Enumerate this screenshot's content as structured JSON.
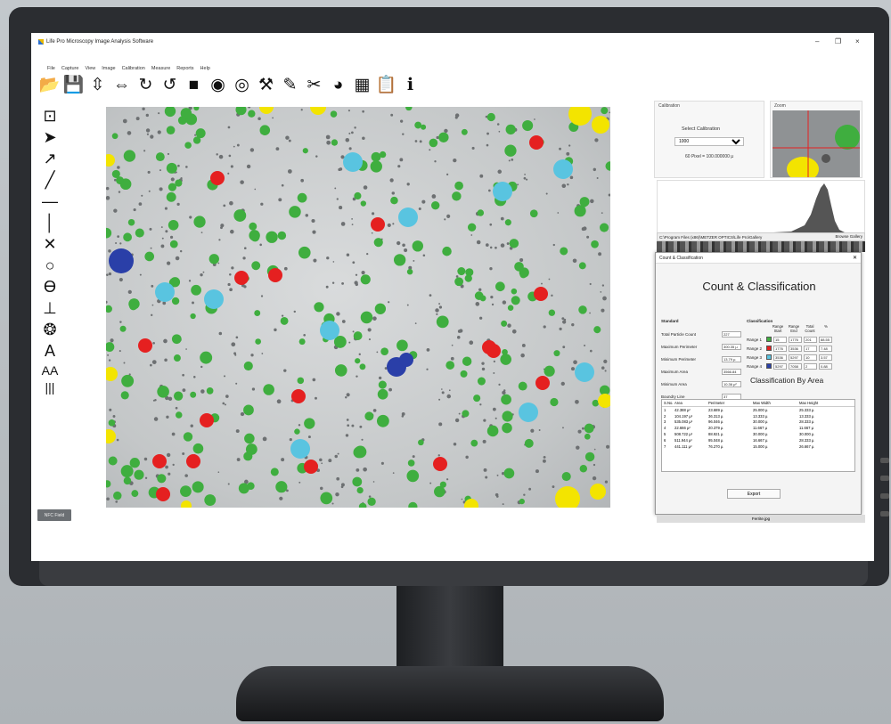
{
  "window": {
    "title": "Life Pro Microscopy Image Analysis Software",
    "controls": [
      "–",
      "❐",
      "×"
    ]
  },
  "menu": [
    "File",
    "Capture",
    "View",
    "Image",
    "Calibration",
    "Measure",
    "Reports",
    "Help"
  ],
  "toolbar": [
    {
      "name": "open-folder-icon",
      "glyph": "📂"
    },
    {
      "name": "save-icon",
      "glyph": "💾"
    },
    {
      "name": "flip-vertical-icon",
      "glyph": "⇳"
    },
    {
      "name": "flip-horizontal-icon",
      "glyph": "⇔"
    },
    {
      "name": "rotate-right-icon",
      "glyph": "↻"
    },
    {
      "name": "rotate-left-icon",
      "glyph": "↺"
    },
    {
      "name": "video-camera-icon",
      "glyph": "■"
    },
    {
      "name": "camera-icon",
      "glyph": "◉"
    },
    {
      "name": "aperture-icon",
      "glyph": "◎"
    },
    {
      "name": "pick-tool-icon",
      "glyph": "⚒"
    },
    {
      "name": "ruler-icon",
      "glyph": "✎"
    },
    {
      "name": "scissors-icon",
      "glyph": "✂"
    },
    {
      "name": "pie-chart-icon",
      "glyph": "◕"
    },
    {
      "name": "grid-table-icon",
      "glyph": "▦"
    },
    {
      "name": "report-icon",
      "glyph": "📋"
    },
    {
      "name": "info-icon",
      "glyph": "ℹ"
    }
  ],
  "left_tools": [
    {
      "name": "snapshot-icon",
      "glyph": "⊡"
    },
    {
      "name": "pointer-arrow-icon",
      "glyph": "➤"
    },
    {
      "name": "arrow-line-icon",
      "glyph": "↗"
    },
    {
      "name": "line-icon",
      "glyph": "╱"
    },
    {
      "name": "horizontal-line-icon",
      "glyph": "—"
    },
    {
      "name": "vertical-line-icon",
      "glyph": "│"
    },
    {
      "name": "cross-icon",
      "glyph": "✕"
    },
    {
      "name": "circle-icon",
      "glyph": "○"
    },
    {
      "name": "circle-diameter-icon",
      "glyph": "ϴ"
    },
    {
      "name": "perpendicular-icon",
      "glyph": "⊥"
    },
    {
      "name": "particle-icon",
      "glyph": "❂"
    },
    {
      "name": "text-icon",
      "glyph": "A"
    },
    {
      "name": "text-size-icon",
      "glyph": "AA"
    },
    {
      "name": "barcode-icon",
      "glyph": "|||"
    }
  ],
  "status_button": "NFC Field",
  "calibration": {
    "caption": "Calibration",
    "select_label": "Select Calibration",
    "selected": "1000",
    "pixel_ratio": "60 Pixel = 100.000000 µ"
  },
  "zoom": {
    "caption": "Zoom"
  },
  "path": {
    "text": "C:\\Program Files (x86)\\METZER OPTICS\\Life Pro\\Gallery",
    "browse": "Browse Gallery"
  },
  "dialog": {
    "title": "Count & Classification",
    "heading": "Count & Classification",
    "standard": {
      "caption": "Standard",
      "rows": [
        {
          "label": "Total Particle Count",
          "value": "227"
        },
        {
          "label": "Maximum Perimeter",
          "value": "300.35 µ"
        },
        {
          "label": "Minimum Perimeter",
          "value": "13.79 µ"
        },
        {
          "label": "Maximum Area",
          "value": "3566.84"
        },
        {
          "label": "Minimum Area",
          "value": "10.36 µ²"
        },
        {
          "label": "Boundry Line",
          "value": "37"
        }
      ]
    },
    "classification": {
      "caption": "Classification",
      "headers": [
        "Range Start",
        "Range End",
        "Total Count",
        "%"
      ],
      "rows": [
        {
          "label": "Range 1",
          "color": "#3fae3f",
          "start": "15",
          "end": "1776",
          "count": "201",
          "pct": "88.55"
        },
        {
          "label": "Range 2",
          "color": "#e52020",
          "start": "1776",
          "end": "3536",
          "count": "17",
          "pct": "7.48"
        },
        {
          "label": "Range 3",
          "color": "#59c4e0",
          "start": "3536",
          "end": "5297",
          "count": "10",
          "pct": "3.57"
        },
        {
          "label": "Range 4",
          "color": "#2a3fa8",
          "start": "5297",
          "end": "7058",
          "count": "2",
          "pct": "0.88"
        }
      ]
    },
    "classification_by": "Classification By Area",
    "table": {
      "headers": [
        "S.No.",
        "Area",
        "Perimeter",
        "Max Width",
        "Max Height"
      ],
      "rows": [
        [
          "1",
          "42.388 µ²",
          "23.689 µ",
          "25.000 µ",
          "25.333 µ"
        ],
        [
          "2",
          "104.197 µ²",
          "36.313 µ",
          "13.333 µ",
          "13.333 µ"
        ],
        [
          "3",
          "535.083 µ²",
          "96.046 µ",
          "30.000 µ",
          "28.333 µ"
        ],
        [
          "4",
          "22.666 µ²",
          "20.379 µ",
          "11.667 µ",
          "11.667 µ"
        ],
        [
          "5",
          "508.722 µ²",
          "88.921 µ",
          "30.000 µ",
          "30.000 µ"
        ],
        [
          "6",
          "511.944 µ²",
          "95.048 µ",
          "16.667 µ",
          "28.333 µ"
        ],
        [
          "7",
          "441.111 µ²",
          "76.270 µ",
          "15.000 µ",
          "26.667 µ"
        ]
      ]
    },
    "export": "Export",
    "file_name": "Ferrite.jpg"
  },
  "particle_colors": {
    "green": "#3fae3f",
    "red": "#e52020",
    "cyan": "#59c4e0",
    "blue": "#2a3fa8",
    "yellow": "#f3e400"
  }
}
